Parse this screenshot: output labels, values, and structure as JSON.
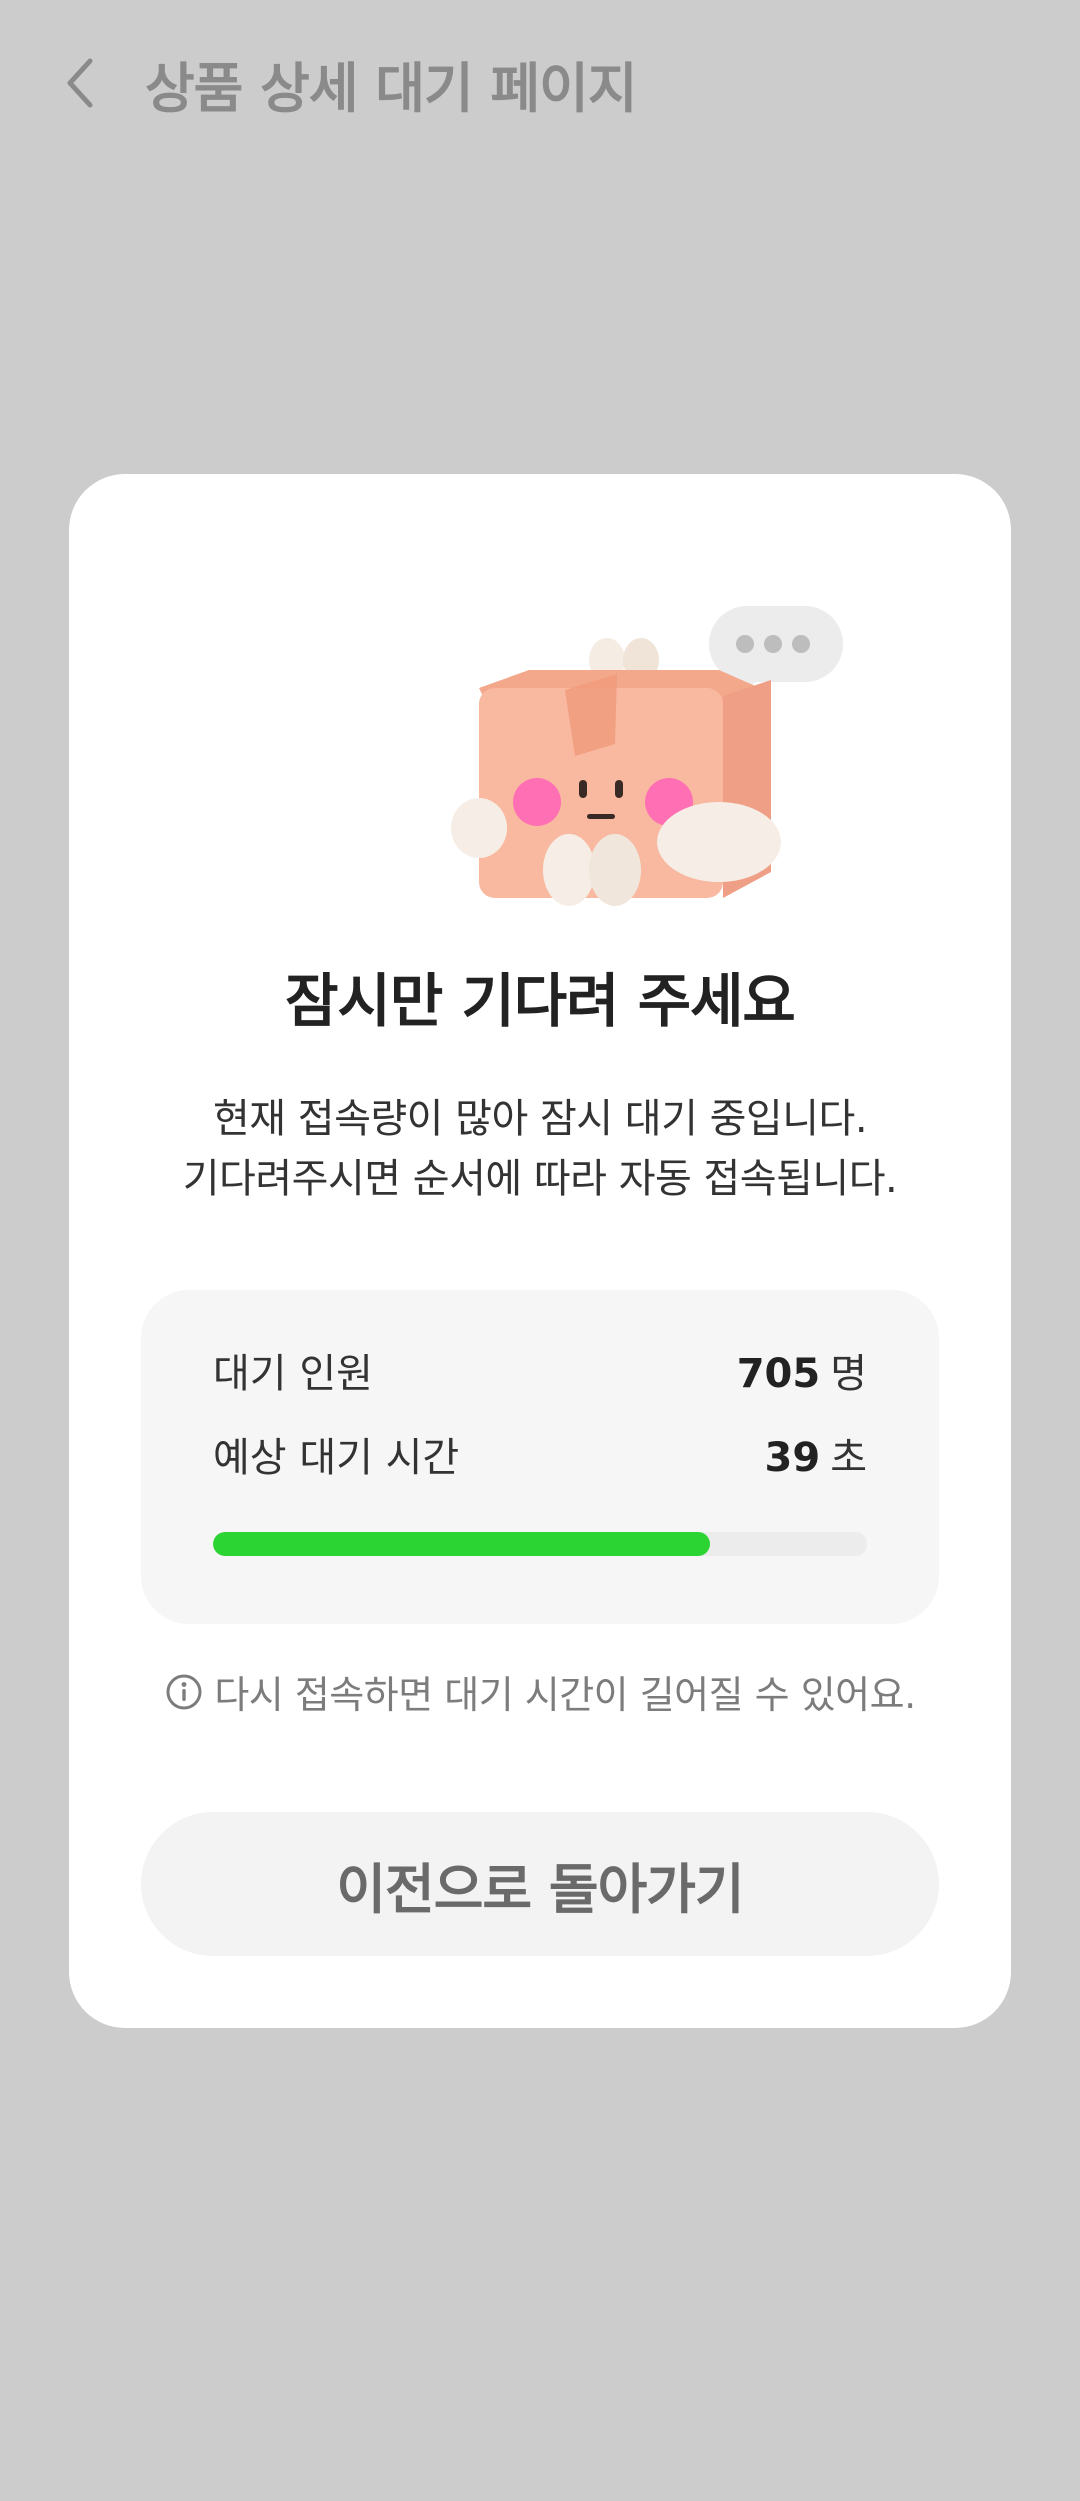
{
  "header": {
    "back_icon": "chevron-left-icon",
    "title": "상품 상세 대기 페이지"
  },
  "card": {
    "mascot_icon": "box-mascot-illustration",
    "title": "잠시만 기다려 주세요",
    "description_lines": [
      "현재 접속량이 많아 잠시 대기 중입니다.",
      "기다려주시면 순서에 따라 자동 접속됩니다."
    ],
    "queue": {
      "waiting_label": "대기 인원",
      "waiting_count": "705",
      "waiting_unit": "명",
      "eta_label": "예상 대기 시간",
      "eta_value": "39",
      "eta_unit": "초",
      "progress_percent": 76
    },
    "notice_icon": "info-circle-icon",
    "notice": "다시 접속하면 대기 시간이 길어질 수 있어요.",
    "back_button_label": "이전으로 돌아가기"
  },
  "colors": {
    "background": "#cccccc",
    "card": "#ffffff",
    "progress": "#2bd432",
    "mascot_body": "#f8b79f",
    "mascot_cheek": "#ff6fb3"
  }
}
